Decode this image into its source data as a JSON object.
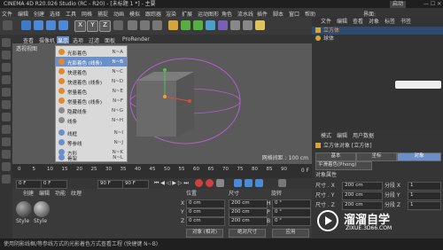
{
  "window": {
    "title": "CINEMA 4D R20.026 Studio (RC - R20) - [未标题 1 *] - 主要",
    "layout_value": "启动"
  },
  "menubar": [
    "文件",
    "编辑",
    "创建",
    "选择",
    "工具",
    "网格",
    "捕捉",
    "动画",
    "模拟",
    "跟踪器",
    "渲染",
    "扩展",
    "运动图形",
    "角色",
    "流水线",
    "插件",
    "脚本",
    "窗口",
    "帮助",
    "界面:"
  ],
  "viewport_menu": {
    "items": [
      "查看",
      "摄像机",
      "显示",
      "选项",
      "过滤",
      "面板",
      "ProRender"
    ],
    "camera_label": "透视视图",
    "grid_label": "网格间距 : 100 cm"
  },
  "display_menu": [
    {
      "label": "光影着色",
      "shortcut": "N~A"
    },
    {
      "label": "光影着色 (线条)",
      "shortcut": "N~B",
      "selected": true
    },
    {
      "label": "快速着色",
      "shortcut": "N~C"
    },
    {
      "label": "快速着色 (线条)",
      "shortcut": "N~D"
    },
    {
      "label": "常量着色",
      "shortcut": "N~E"
    },
    {
      "label": "常量着色 (线条)",
      "shortcut": "N~F"
    },
    {
      "label": "隐藏线条",
      "shortcut": "N~G"
    },
    {
      "label": "线条",
      "shortcut": "N~H"
    },
    {
      "label": "线框",
      "shortcut": "N~I"
    },
    {
      "label": "等参线",
      "shortcut": "N~J"
    },
    {
      "label": "方形",
      "shortcut": "N~K"
    },
    {
      "label": "骨架",
      "shortcut": "N~L"
    }
  ],
  "timeline": {
    "ticks": [
      "0",
      "5",
      "10",
      "15",
      "20",
      "25",
      "30",
      "35",
      "40",
      "45",
      "50",
      "55",
      "60",
      "65",
      "70",
      "75",
      "80",
      "85",
      "90"
    ],
    "frame_end": "0 F"
  },
  "playbar": {
    "start": "0 F",
    "current": "0 F",
    "end": "90 F",
    "end2": "90 F"
  },
  "material_panel": {
    "menu": [
      "创建",
      "编辑",
      "功能",
      "纹理"
    ],
    "materials": [
      "Style",
      "Style"
    ]
  },
  "coord_panel": {
    "headers": [
      "位置",
      "尺寸",
      "旋转"
    ],
    "rows": [
      {
        "axis": "X",
        "pos": "0 cm",
        "size": "200 cm",
        "rot_axis": "H",
        "rot": "0 °"
      },
      {
        "axis": "Y",
        "pos": "0 cm",
        "size": "200 cm",
        "rot_axis": "P",
        "rot": "0 °"
      },
      {
        "axis": "Z",
        "pos": "0 cm",
        "size": "200 cm",
        "rot_axis": "B",
        "rot": "0 °"
      }
    ],
    "mode_a": "对象 (相对)",
    "mode_b": "绝对尺寸",
    "apply": "应用"
  },
  "object_panel": {
    "menu": [
      "文件",
      "编辑",
      "查看",
      "对象",
      "标签",
      "书签"
    ],
    "objects": [
      "立方体",
      "球体"
    ]
  },
  "attr_panel": {
    "menu": [
      "模式",
      "编辑",
      "用户数据"
    ],
    "object_title": "立方体对象 [立方体]",
    "tabs": [
      "基本",
      "坐标",
      "对象"
    ],
    "phong": "平滑着色(Phong)",
    "section": "对象属性",
    "rows": [
      {
        "label": "尺寸 . X",
        "value": "200 cm",
        "seg_label": "分段 X",
        "seg": "1"
      },
      {
        "label": "尺寸 . Y",
        "value": "200 cm",
        "seg_label": "分段 Y",
        "seg": "1"
      },
      {
        "label": "尺寸 . Z",
        "value": "200 cm",
        "seg_label": "分段 Z",
        "seg": "1"
      }
    ]
  },
  "watermark": {
    "title": "溜溜自学",
    "url": "ZIXUE.3D66.COM"
  },
  "status": "使用阴影线框/等参线方式的光影着色方式查看工程 (快捷键 N~B)",
  "colors": {
    "accent": "#e08a2c",
    "selection": "#6b8fc9",
    "cube": "#6a6a6a"
  }
}
